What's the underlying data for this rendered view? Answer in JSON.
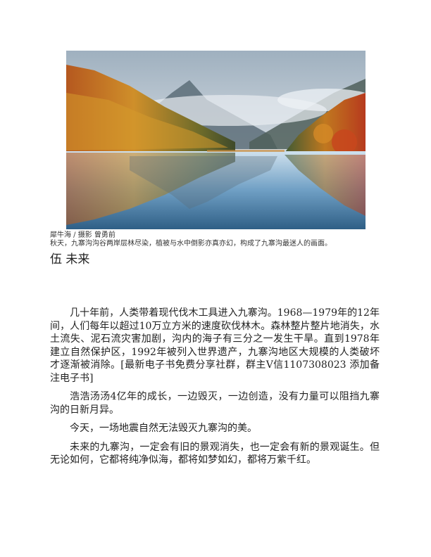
{
  "photo": {
    "alt": "秋天，九寨沟沟谷两岸层林尽染，植被与水中倒影亦真亦幻"
  },
  "caption": {
    "credit": "犀牛海 / 摄影 曾勇前",
    "text": "秋天，九寨沟沟谷两岸层林尽染，植被与水中倒影亦真亦幻，构成了九寨沟最迷人的画面。"
  },
  "section": {
    "title": "伍 未来"
  },
  "paragraphs": [
    "几十年前，人类带着现代伐木工具进入九寨沟。1968—1979年的12年间，人们每年以超过10万立方米的速度砍伐林木。森林整片整片地消失，水土流失、泥石流灾害加剧，沟内的海子有三分之一发生干旱。直到1978年建立自然保护区，1992年被列入世界遗产，九寨沟地区大规模的人类破坏才逐渐被消除。[最新电子书免费分享社群，群主V信1107308023 添加备注电子书]",
    "浩浩汤汤4亿年的成长，一边毁灭，一边创造，没有力量可以阻挡九寨沟的日新月异。",
    "今天，一场地震自然无法毁灭九寨沟的美。",
    "未来的九寨沟，一定会有旧的景观消失，也一定会有新的景观诞生。但无论如何，它都将纯净似海，都将如梦如幻，都将万紫千红。"
  ]
}
